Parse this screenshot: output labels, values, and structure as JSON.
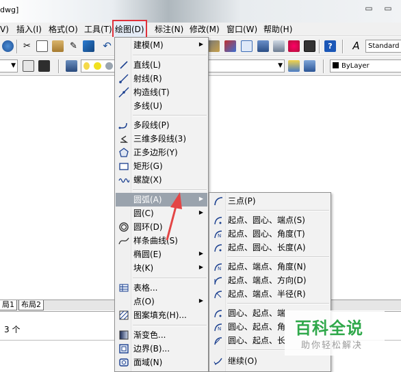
{
  "window": {
    "title": "dwg]"
  },
  "menubar": {
    "items": [
      {
        "label": "V)"
      },
      {
        "label": "插入(I)"
      },
      {
        "label": "格式(O)"
      },
      {
        "label": "工具(T)"
      },
      {
        "label": "绘图(D)"
      },
      {
        "label": "标注(N)"
      },
      {
        "label": "修改(M)"
      },
      {
        "label": "窗口(W)"
      },
      {
        "label": "帮助(H)"
      }
    ]
  },
  "toolbar": {
    "text_style": "Standard",
    "layer_linetype": "ByLayer"
  },
  "layout_tabs": [
    "局1",
    "布局2"
  ],
  "command_line": {
    "text": "3 个"
  },
  "draw_menu": {
    "items": [
      {
        "label": "建模(M)",
        "submenu": "▶"
      },
      {
        "label": "直线(L)"
      },
      {
        "label": "射线(R)"
      },
      {
        "label": "构造线(T)"
      },
      {
        "label": "多线(U)"
      },
      {
        "label": "多段线(P)"
      },
      {
        "label": "三维多段线(3)"
      },
      {
        "label": "正多边形(Y)"
      },
      {
        "label": "矩形(G)"
      },
      {
        "label": "螺旋(X)"
      },
      {
        "label": "圆弧(A)",
        "submenu": "▶"
      },
      {
        "label": "圆(C)",
        "submenu": "▶"
      },
      {
        "label": "圆环(D)"
      },
      {
        "label": "样条曲线(S)"
      },
      {
        "label": "椭圆(E)",
        "submenu": "▶"
      },
      {
        "label": "块(K)",
        "submenu": "▶"
      },
      {
        "label": "表格..."
      },
      {
        "label": "点(O)",
        "submenu": "▶"
      },
      {
        "label": "图案填充(H)..."
      },
      {
        "label": "渐变色..."
      },
      {
        "label": "边界(B)..."
      },
      {
        "label": "面域(N)"
      }
    ]
  },
  "arc_submenu": {
    "items": [
      {
        "label": "三点(P)"
      },
      {
        "label": "起点、圆心、端点(S)"
      },
      {
        "label": "起点、圆心、角度(T)"
      },
      {
        "label": "起点、圆心、长度(A)"
      },
      {
        "label": "起点、端点、角度(N)"
      },
      {
        "label": "起点、端点、方向(D)"
      },
      {
        "label": "起点、端点、半径(R)"
      },
      {
        "label": "圆心、起点、端"
      },
      {
        "label": "圆心、起点、角"
      },
      {
        "label": "圆心、起点、长"
      },
      {
        "label": "继续(O)"
      }
    ]
  },
  "watermark": {
    "title": "百科全说",
    "subtitle": "助你轻松解决"
  },
  "colors": {
    "highlight_box": "#e0303a",
    "active_row": "#9aa3ad",
    "watermark_green": "#2fa84a"
  }
}
